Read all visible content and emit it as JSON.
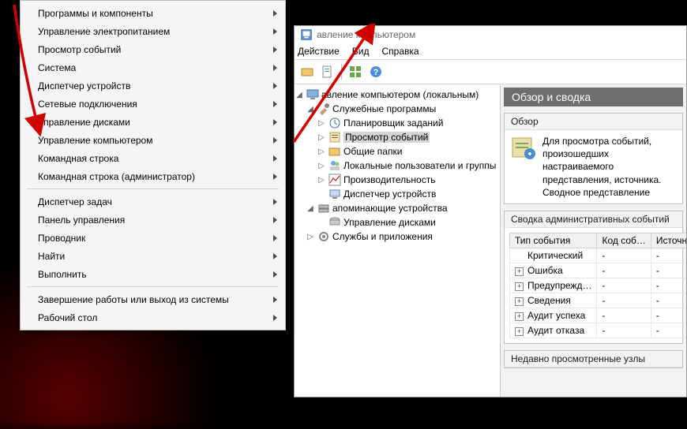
{
  "contextMenu": {
    "groups": [
      [
        "Программы и компоненты",
        "Управление электропитанием",
        "Просмотр событий",
        "Система",
        "Диспетчер устройств",
        "Сетевые подключения",
        "Управление дисками",
        "Управление компьютером",
        "Командная строка",
        "Командная строка (администратор)"
      ],
      [
        "Диспетчер задач",
        "Панель управления",
        "Проводник",
        "Найти",
        "Выполнить"
      ],
      [
        {
          "label": "Завершение работы или выход из системы",
          "sub": true
        },
        "Рабочий стол"
      ]
    ]
  },
  "mmc": {
    "title": "авление компьютером",
    "menus": [
      "Действие",
      "Вид",
      "Справка"
    ],
    "tree": {
      "root": "авление компьютером (локальным)",
      "svc": "Службы и приложения",
      "system_tools": {
        "label": "Служебные программы",
        "children": [
          "Планировщик заданий",
          "Просмотр событий",
          "Общие папки",
          "Локальные пользователи и группы",
          "Производительность",
          "Диспетчер устройств"
        ]
      },
      "storage": {
        "label": "апоминающие устройства",
        "children": [
          "Управление дисками"
        ]
      }
    },
    "right": {
      "header": "Обзор и сводка",
      "overview_title": "Обзор",
      "overview_text": "Для просмотра событий, произошедших настраиваемого представления, источника. Сводное представление",
      "summary_title": "Сводка административных событий",
      "recent_title": "Недавно просмотренные узлы",
      "table": {
        "cols": [
          "Тип события",
          "Код соб…",
          "Источник"
        ],
        "rows": [
          [
            "Критический",
            "-",
            "-"
          ],
          [
            "Ошибка",
            "-",
            "-"
          ],
          [
            "Предупрежд…",
            "-",
            "-"
          ],
          [
            "Сведения",
            "-",
            "-"
          ],
          [
            "Аудит успеха",
            "-",
            "-"
          ],
          [
            "Аудит отказа",
            "-",
            "-"
          ]
        ]
      }
    }
  }
}
